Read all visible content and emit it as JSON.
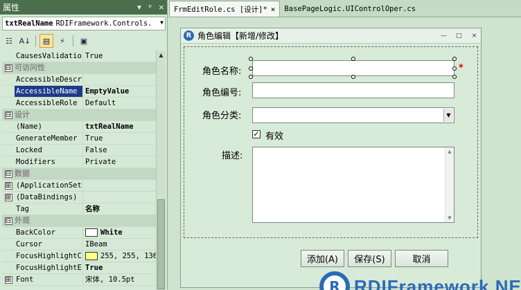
{
  "properties_panel": {
    "title": "属性",
    "buttons": [
      "▾",
      "ᵖ",
      "×"
    ],
    "object_name": "txtRealName",
    "object_type": "RDIFramework.Controls.",
    "rows": [
      {
        "kind": "prop",
        "name": "CausesValidatio",
        "value": "True"
      },
      {
        "kind": "cat",
        "name": "可访问性",
        "expander": "⊟"
      },
      {
        "kind": "prop",
        "name": "AccessibleDescr",
        "value": ""
      },
      {
        "kind": "prop",
        "name": "AccessibleName",
        "value": "EmptyValue",
        "selected": true,
        "bold": true
      },
      {
        "kind": "prop",
        "name": "AccessibleRole",
        "value": "Default"
      },
      {
        "kind": "cat",
        "name": "设计",
        "expander": "⊟"
      },
      {
        "kind": "prop",
        "name": "(Name)",
        "value": "txtRealName",
        "bold": true
      },
      {
        "kind": "prop",
        "name": "GenerateMember",
        "value": "True"
      },
      {
        "kind": "prop",
        "name": "Locked",
        "value": "False"
      },
      {
        "kind": "prop",
        "name": "Modifiers",
        "value": "Private"
      },
      {
        "kind": "cat",
        "name": "数据",
        "expander": "⊟"
      },
      {
        "kind": "prop",
        "name": "(ApplicationSet",
        "value": "",
        "expander": "⊞"
      },
      {
        "kind": "prop",
        "name": "(DataBindings)",
        "value": "",
        "expander": "⊞"
      },
      {
        "kind": "prop",
        "name": "Tag",
        "value": "名称",
        "bold": true
      },
      {
        "kind": "cat",
        "name": "外观",
        "expander": "⊟"
      },
      {
        "kind": "prop",
        "name": "BackColor",
        "value": "White",
        "bold": true,
        "swatch": "#ffffff"
      },
      {
        "kind": "prop",
        "name": "Cursor",
        "value": "IBeam"
      },
      {
        "kind": "prop",
        "name": "FocusHighlightC",
        "value": "255, 255, 136",
        "swatch": "#ffff88"
      },
      {
        "kind": "prop",
        "name": "FocusHighlightE",
        "value": "True",
        "bold": true
      },
      {
        "kind": "prop",
        "name": "Font",
        "value": "宋体, 10.5pt",
        "expander": "⊞"
      }
    ]
  },
  "tabs": [
    {
      "label": "FrmEditRole.cs [设计]*",
      "active": true,
      "close": "×"
    },
    {
      "label": "BasePageLogic.UIControlOper.cs",
      "active": false,
      "close": ""
    }
  ],
  "form": {
    "logo": "R",
    "title": "角色编辑【新增/修改】",
    "controls": [
      "—",
      "□",
      "×"
    ],
    "labels": {
      "role_name": "角色名称:",
      "role_code": "角色编号:",
      "role_category": "角色分类:",
      "enabled": "有效",
      "description": "描述:"
    },
    "required_mark": "*",
    "enabled_checked": "✓",
    "buttons": {
      "add": "添加(A)",
      "save": "保存(S)",
      "cancel": "取消"
    }
  },
  "brand": {
    "logo": "R",
    "text": "RDIFramework.NET"
  }
}
